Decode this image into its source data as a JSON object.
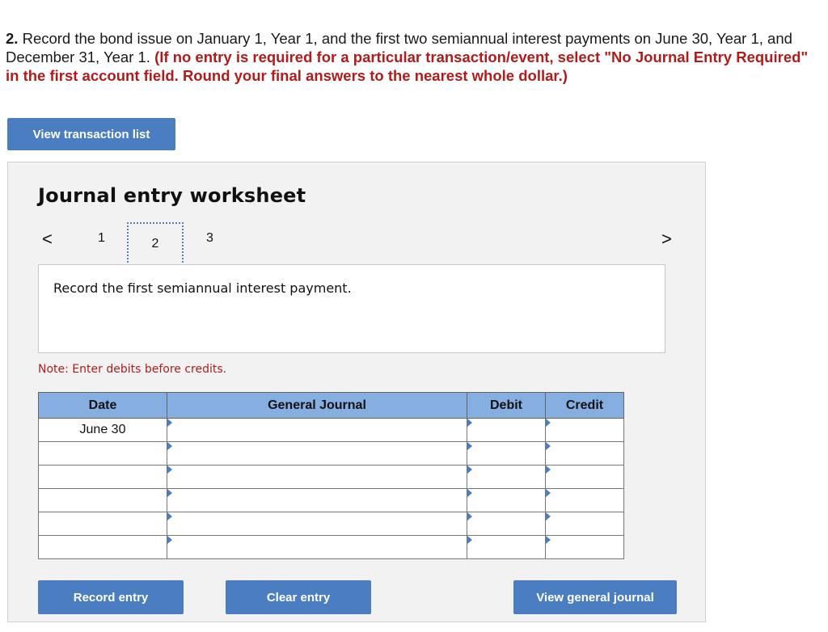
{
  "question": {
    "number": "2.",
    "text": " Record the bond issue on January 1, Year 1, and the first two semiannual interest payments on June 30, Year 1, and December 31, Year 1. ",
    "instruction": "(If no entry is required for a particular transaction/event, select \"No Journal Entry Required\" in the first account field. Round your final answers to the nearest whole dollar.)"
  },
  "buttons": {
    "view_transaction_list": "View transaction list",
    "record_entry": "Record entry",
    "clear_entry": "Clear entry",
    "view_general_journal": "View general journal"
  },
  "worksheet": {
    "title": "Journal entry worksheet",
    "nav_prev": "<",
    "nav_next": ">",
    "pages": [
      "1",
      "2",
      "3"
    ],
    "current_page": "2",
    "prompt": "Record the first semiannual interest payment.",
    "note": "Note: Enter debits before credits."
  },
  "journal": {
    "headers": {
      "date": "Date",
      "general_journal": "General Journal",
      "debit": "Debit",
      "credit": "Credit"
    },
    "rows": [
      {
        "date": "June 30",
        "account": "",
        "debit": "",
        "credit": ""
      },
      {
        "date": "",
        "account": "",
        "debit": "",
        "credit": ""
      },
      {
        "date": "",
        "account": "",
        "debit": "",
        "credit": ""
      },
      {
        "date": "",
        "account": "",
        "debit": "",
        "credit": ""
      },
      {
        "date": "",
        "account": "",
        "debit": "",
        "credit": ""
      },
      {
        "date": "",
        "account": "",
        "debit": "",
        "credit": ""
      }
    ]
  },
  "colors": {
    "button": "#4a7ec0",
    "header": "#86aee0",
    "instruction": "#b01c1c"
  }
}
